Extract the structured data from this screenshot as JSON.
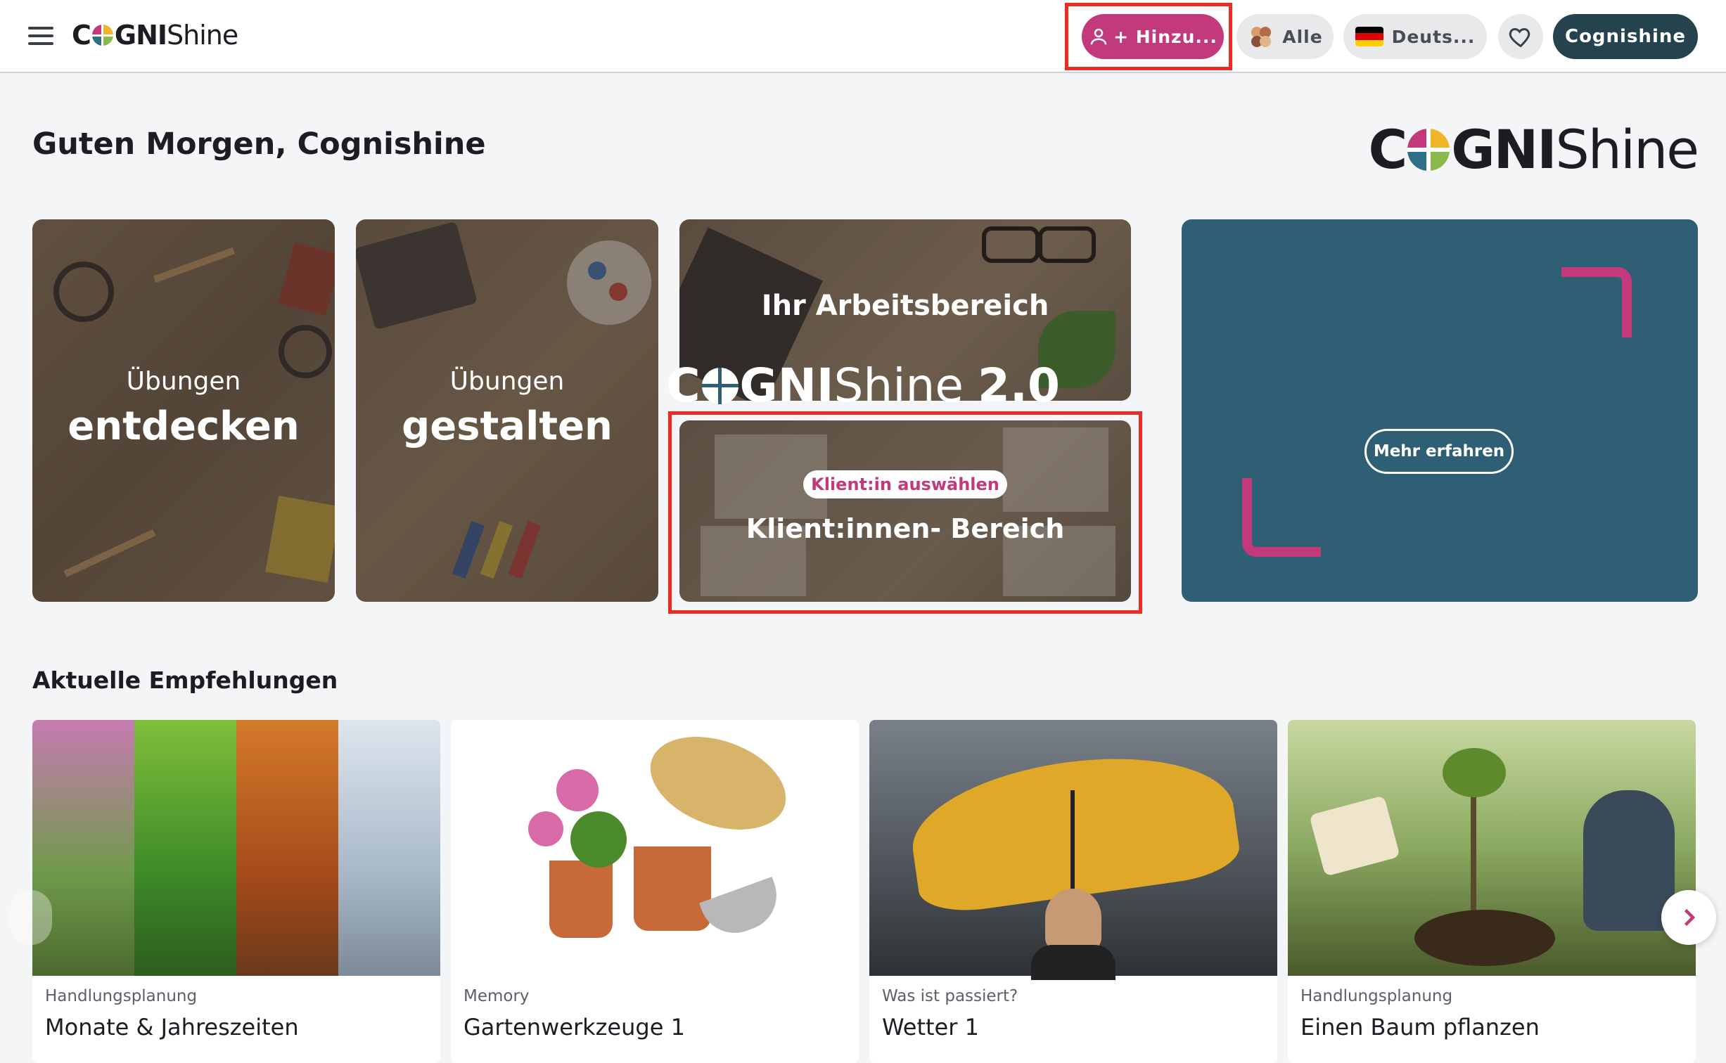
{
  "header": {
    "menu_icon": "hamburger-icon",
    "logo": {
      "part1": "C",
      "part2": "GNI",
      "part3": "Shine"
    },
    "add_client_label": "+ Hinzu...",
    "filter_label": "Alle",
    "language_label": "Deuts...",
    "favorites_icon": "heart-icon",
    "user_label": "Cognishine"
  },
  "greeting": "Guten Morgen, Cognishine",
  "big_logo": {
    "part1": "C",
    "part2": "GNI",
    "part3": "Shine"
  },
  "tiles": [
    {
      "line1": "Übungen",
      "line2": "entdecken"
    },
    {
      "line1": "Übungen",
      "line2": "gestalten"
    },
    {
      "label": "Ihr Arbeitsbereich"
    },
    {
      "badge": "Klient:in auswählen",
      "label": "Klient:innen- Bereich"
    }
  ],
  "promo": {
    "part1": "C",
    "part2": "GNI",
    "part3": "Shine",
    "version": "2.0",
    "button": "Mehr erfahren"
  },
  "recommendations": {
    "title": "Aktuelle Empfehlungen",
    "cards": [
      {
        "category": "Handlungsplanung",
        "title": "Monate & Jahreszeiten"
      },
      {
        "category": "Memory",
        "title": "Gartenwerkzeuge 1"
      },
      {
        "category": "Was ist passiert?",
        "title": "Wetter 1"
      },
      {
        "category": "Handlungsplanung",
        "title": "Einen Baum pflanzen"
      }
    ]
  },
  "colors": {
    "brand_pink": "#c23a7c",
    "brand_dark": "#25424f",
    "promo_bg": "#2e5f74",
    "highlight": "#ec2b24"
  }
}
